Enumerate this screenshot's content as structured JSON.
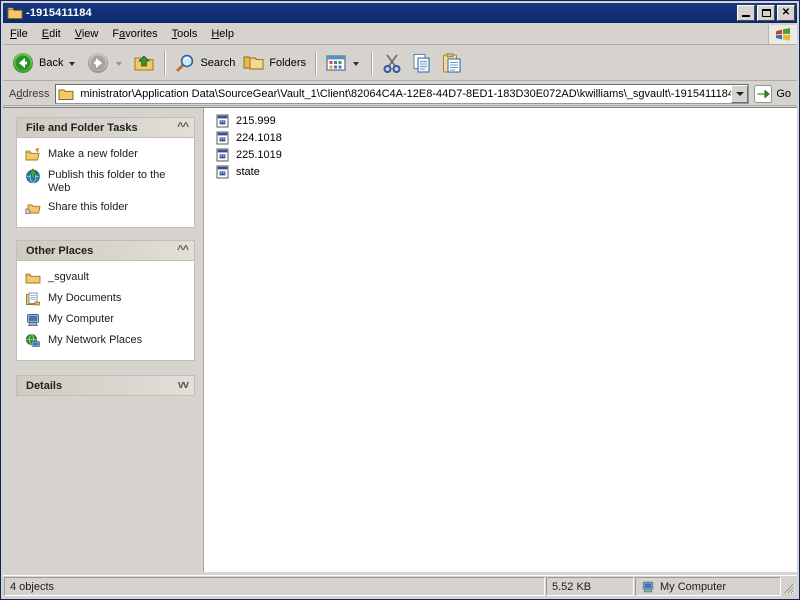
{
  "window": {
    "title": "-1915411184",
    "icon": "folder-icon",
    "controls": {
      "minimize": "Minimize",
      "maximize": "Maximize",
      "close": "Close"
    }
  },
  "menubar": {
    "items": [
      {
        "label": "File",
        "accel": "F"
      },
      {
        "label": "Edit",
        "accel": "E"
      },
      {
        "label": "View",
        "accel": "V"
      },
      {
        "label": "Favorites",
        "accel": "a"
      },
      {
        "label": "Tools",
        "accel": "T"
      },
      {
        "label": "Help",
        "accel": "H"
      }
    ],
    "brand_icon": "windows-flag-icon"
  },
  "toolbar": {
    "back_label": "Back",
    "forward_label": "",
    "up_label": "",
    "search_label": "Search",
    "folders_label": "Folders",
    "views_label": "",
    "cut_label": "",
    "copy_label": "",
    "paste_label": ""
  },
  "address": {
    "label": "Address",
    "value": "ministrator\\Application Data\\SourceGear\\Vault_1\\Client\\82064C4A-12E8-44D7-8ED1-183D30E072AD\\kwilliams\\_sgvault\\-1915411184",
    "placeholder": "",
    "go_label": "Go"
  },
  "sidebar": {
    "panels": [
      {
        "title": "File and Folder Tasks",
        "state": "expanded",
        "toggle_icon": "chevron-up-icon",
        "items": [
          {
            "label": "Make a new folder",
            "icon": "new-folder-icon"
          },
          {
            "label": "Publish this folder to the Web",
            "icon": "publish-web-icon"
          },
          {
            "label": "Share this folder",
            "icon": "share-folder-icon"
          }
        ]
      },
      {
        "title": "Other Places",
        "state": "expanded",
        "toggle_icon": "chevron-up-icon",
        "items": [
          {
            "label": "_sgvault",
            "icon": "folder-icon"
          },
          {
            "label": "My Documents",
            "icon": "my-documents-icon"
          },
          {
            "label": "My Computer",
            "icon": "my-computer-icon"
          },
          {
            "label": "My Network Places",
            "icon": "network-places-icon"
          }
        ]
      },
      {
        "title": "Details",
        "state": "collapsed",
        "toggle_icon": "chevron-down-icon",
        "items": []
      }
    ]
  },
  "files": {
    "items": [
      {
        "name": "215.999",
        "icon": "unknown-file-icon"
      },
      {
        "name": "224.1018",
        "icon": "unknown-file-icon"
      },
      {
        "name": "225.1019",
        "icon": "unknown-file-icon"
      },
      {
        "name": "state",
        "icon": "unknown-file-icon"
      }
    ]
  },
  "statusbar": {
    "objects": "4 objects",
    "size": "5.52 KB",
    "zone": "My Computer",
    "zone_icon": "my-computer-icon"
  },
  "colors": {
    "titlebar": "#13307a",
    "chrome": "#d6d3ce",
    "panel_header": "#d9d6cf",
    "list_background": "#ffffff",
    "folder_yellow": "#f6d67b"
  }
}
